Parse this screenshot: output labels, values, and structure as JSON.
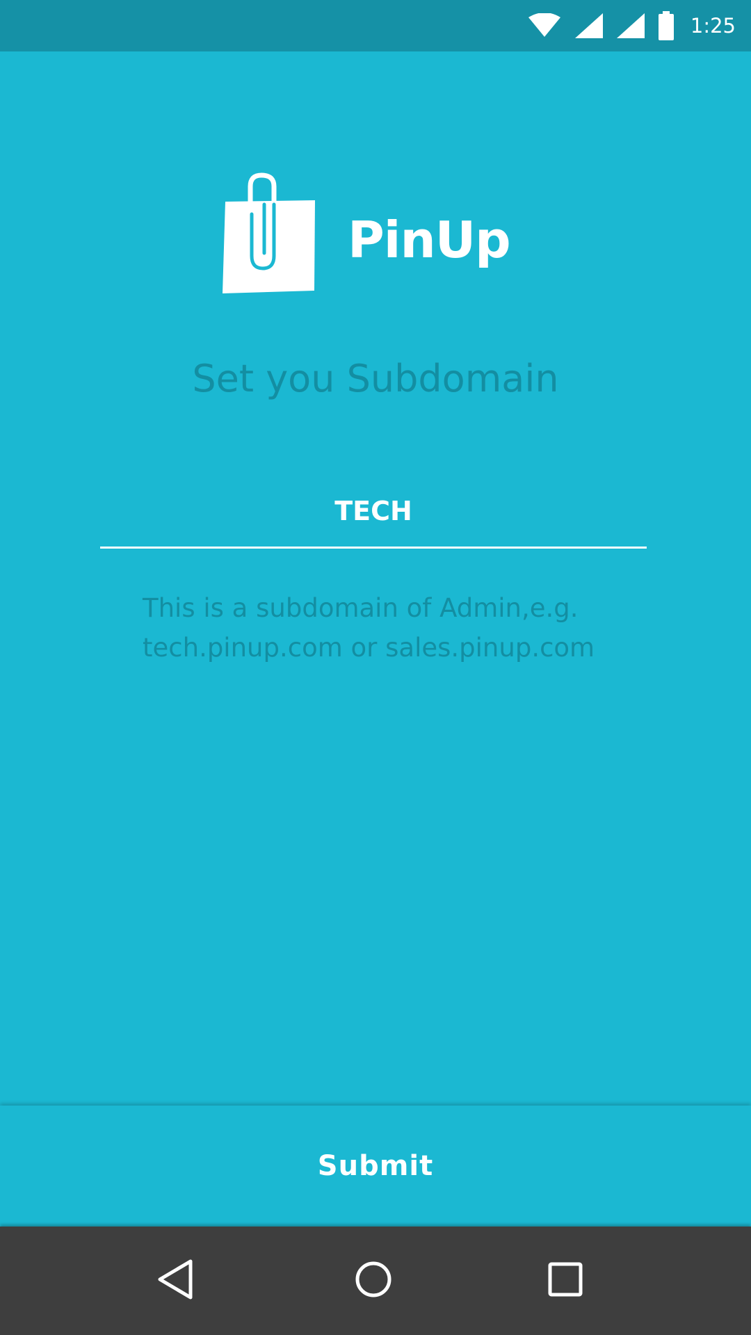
{
  "status_bar": {
    "time": "1:25",
    "icons": [
      "wifi-icon",
      "signal-icon",
      "signal-icon",
      "battery-icon"
    ]
  },
  "app": {
    "brand_name": "PinUp",
    "logo_icon": "shopping-bag-paperclip-icon"
  },
  "form": {
    "heading": "Set you Subdomain",
    "subdomain_value": "TECH",
    "hint": "This is a subdomain of Admin,e.g. tech.pinup.com or sales.pinup.com",
    "submit_label": "Submit"
  },
  "navigation": {
    "icons": [
      "back-icon",
      "home-icon",
      "recents-icon"
    ]
  },
  "colors": {
    "background": "#1bb8d2",
    "status_bar": "#1591a6",
    "muted_text": "#138ea2",
    "nav_bar": "#3e3e3e",
    "white": "#ffffff"
  }
}
